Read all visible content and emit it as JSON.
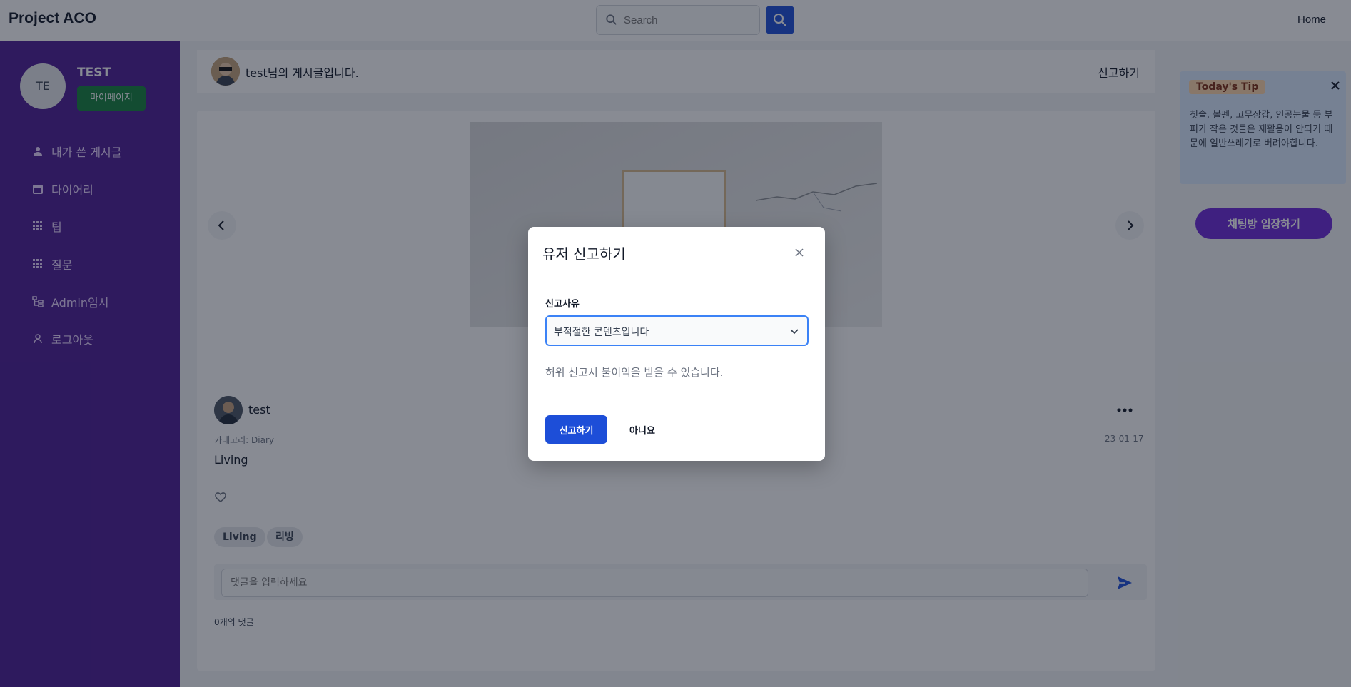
{
  "header": {
    "brand": "Project ACO",
    "search_placeholder": "Search",
    "home_label": "Home"
  },
  "sidebar": {
    "avatar_initials": "TE",
    "user_name": "TEST",
    "mypage_label": "마이페이지",
    "items": [
      {
        "label": "내가 쓴 게시글",
        "icon": "user-icon"
      },
      {
        "label": "다이어리",
        "icon": "calendar-icon"
      },
      {
        "label": "팁",
        "icon": "grid-icon"
      },
      {
        "label": "질문",
        "icon": "grid-icon"
      },
      {
        "label": "Admin임시",
        "icon": "admin-icon"
      },
      {
        "label": "로그아웃",
        "icon": "logout-icon"
      }
    ]
  },
  "post": {
    "header_title": "test님의 게시글입니다.",
    "report_label": "신고하기",
    "author": "test",
    "category": "카테고리: Diary",
    "date": "23-01-17",
    "body": "Living",
    "tags": [
      "Living",
      "리빙"
    ],
    "comment_placeholder": "댓글을 입력하세요",
    "comment_count": "0개의 댓글"
  },
  "tip": {
    "badge": "Today's Tip",
    "text": "칫솔, 볼펜, 고무장갑, 인공눈물 등 부피가 작은 것들은 재활용이 안되기 때문에 일반쓰레기로 버려야합니다.",
    "chat_button": "채팅방 입장하기"
  },
  "modal": {
    "title": "유저 신고하기",
    "field_label": "신고사유",
    "selected_reason": "부적절한 콘텐츠입니다",
    "warning": "허위 신고시 불이익을 받을 수 있습니다.",
    "confirm_label": "신고하기",
    "cancel_label": "아니요"
  },
  "colors": {
    "sidebar": "#4c1d95",
    "primary": "#1d4ed8",
    "mypage": "#15803d",
    "chat": "#6d28d9"
  }
}
